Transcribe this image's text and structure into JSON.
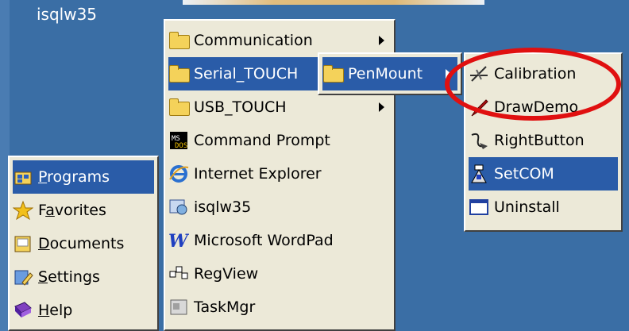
{
  "desktop": {
    "icon_label": "isqlw35"
  },
  "start_menu": {
    "items": [
      {
        "label": "Programs",
        "underline": "P",
        "rest": "rograms",
        "icon": "programs-icon"
      },
      {
        "label": "Favorites",
        "underline": "",
        "pre": "F",
        "mid": "a",
        "rest": "vorites",
        "icon": "star-icon"
      },
      {
        "label": "Documents",
        "underline": "D",
        "rest": "ocuments",
        "icon": "documents-icon"
      },
      {
        "label": "Settings",
        "underline": "S",
        "rest": "ettings",
        "icon": "settings-icon"
      },
      {
        "label": "Help",
        "underline": "H",
        "rest": "elp",
        "icon": "help-icon"
      }
    ]
  },
  "programs_menu": {
    "items": [
      {
        "label": "Communication",
        "icon": "folder-icon",
        "submenu": true
      },
      {
        "label": "Serial_TOUCH",
        "icon": "folder-icon",
        "submenu": true
      },
      {
        "label": "USB_TOUCH",
        "icon": "folder-icon",
        "submenu": true
      },
      {
        "label": "Command Prompt",
        "icon": "command-prompt-icon"
      },
      {
        "label": "Internet Explorer",
        "icon": "internet-explorer-icon"
      },
      {
        "label": "isqlw35",
        "icon": "isqlw35-icon"
      },
      {
        "label": "Microsoft WordPad",
        "icon": "wordpad-icon"
      },
      {
        "label": "RegView",
        "icon": "regview-icon"
      },
      {
        "label": "TaskMgr",
        "icon": "taskmgr-icon"
      }
    ]
  },
  "serial_menu": {
    "items": [
      {
        "label": "PenMount",
        "icon": "folder-icon",
        "submenu": true
      }
    ]
  },
  "penmount_menu": {
    "items": [
      {
        "label": "Calibration",
        "icon": "calibration-icon"
      },
      {
        "label": "DrawDemo",
        "icon": "drawdemo-icon"
      },
      {
        "label": "RightButton",
        "icon": "rightbutton-icon"
      },
      {
        "label": "SetCOM",
        "icon": "setcom-icon"
      },
      {
        "label": "Uninstall",
        "icon": "uninstall-icon"
      }
    ]
  },
  "colors": {
    "desktop": "#3a6ea5",
    "menu_bg": "#ece9d8",
    "selection": "#2a5ca8",
    "highlight_ring": "#e01010"
  }
}
